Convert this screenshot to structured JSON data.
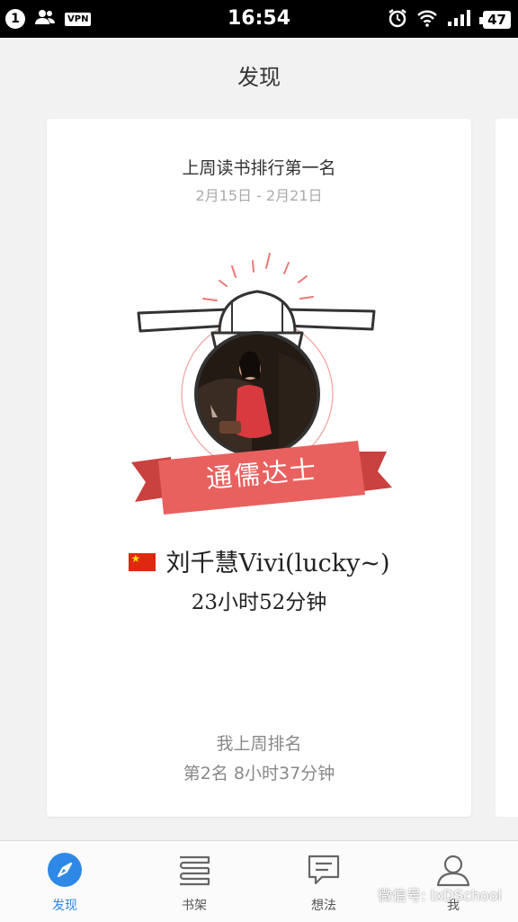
{
  "status": {
    "notification_count": "1",
    "vpn": "VPN",
    "time": "16:54",
    "battery": "47"
  },
  "header": {
    "title": "发现"
  },
  "card": {
    "title": "上周读书排行第一名",
    "date_range": "2月15日 - 2月21日",
    "ribbon_text": "通儒达士",
    "user_name": "刘千慧Vivi(lucky~)",
    "reading_time": "23小时52分钟",
    "my_rank_title": "我上周排名",
    "my_rank_value": "第2名 8小时37分钟"
  },
  "tabs": [
    {
      "label": "发现",
      "icon": "compass-icon",
      "active": true
    },
    {
      "label": "书架",
      "icon": "bookshelf-icon"
    },
    {
      "label": "想法",
      "icon": "chat-icon"
    },
    {
      "label": "我",
      "icon": "person-icon"
    }
  ],
  "watermark": "微信号: lxDSchool",
  "colors": {
    "accent": "#2d89e5",
    "ribbon": "#e8615f",
    "ribbon_dark": "#c9423f"
  }
}
